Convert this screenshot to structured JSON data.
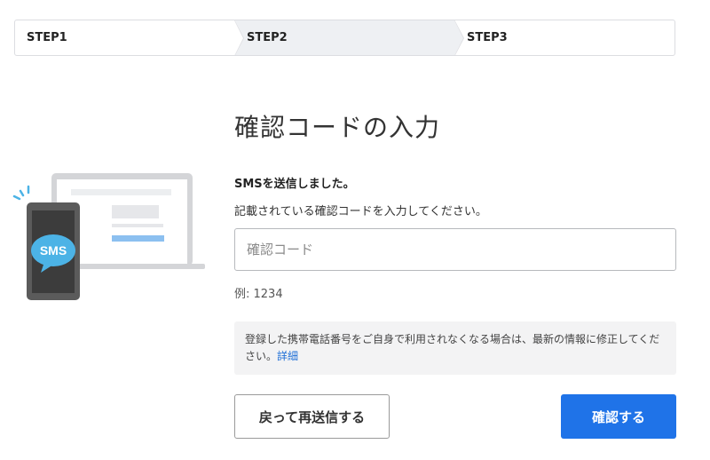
{
  "stepper": {
    "steps": [
      {
        "label": "STEP1",
        "active": false
      },
      {
        "label": "STEP2",
        "active": true
      },
      {
        "label": "STEP3",
        "active": false
      }
    ]
  },
  "illustration": {
    "bubble_text": "SMS",
    "colors": {
      "bubble": "#4cb3e6",
      "phone": "#5a5a5a",
      "laptop": "#d9dadc",
      "accent_bar": "#8cc0f0"
    }
  },
  "main": {
    "title": "確認コードの入力",
    "lead": "SMSを送信しました。",
    "description": "記載されている確認コードを入力してください。",
    "code_input": {
      "placeholder": "確認コード",
      "value": ""
    },
    "example": "例: 1234",
    "notice": {
      "text": "登録した携帯電話番号をご自身で利用されなくなる場合は、最新の情報に修正してください。",
      "link_label": "詳細"
    }
  },
  "actions": {
    "back_label": "戻って再送信する",
    "confirm_label": "確認する"
  },
  "colors": {
    "primary": "#1f73e8",
    "link": "#1f6fd6",
    "active_step_bg": "#eef0f3"
  }
}
